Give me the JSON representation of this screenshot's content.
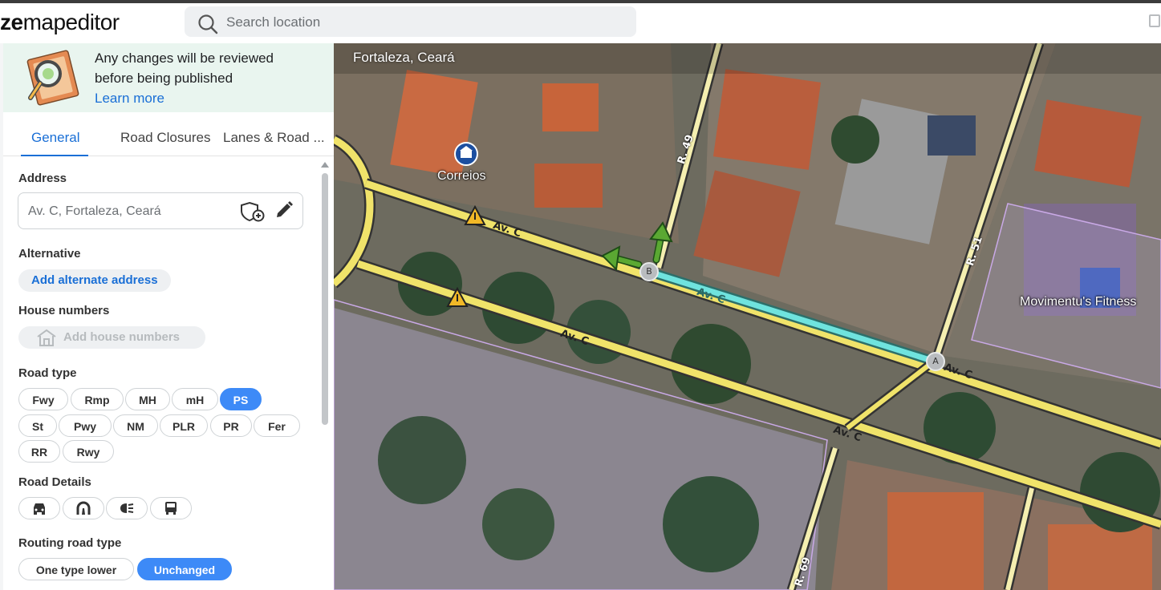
{
  "app": {
    "logo_bold": "ze",
    "logo_light": "mapeditor"
  },
  "search": {
    "placeholder": "Search location"
  },
  "notice": {
    "line1": "Any changes will be reviewed",
    "line2": "before being published",
    "learn_more": "Learn more"
  },
  "tabs": [
    {
      "label": "General",
      "active": true
    },
    {
      "label": "Road Closures",
      "active": false
    },
    {
      "label": "Lanes & Road ...",
      "active": false
    }
  ],
  "address": {
    "label": "Address",
    "placeholder": "Av. C, Fortaleza, Ceará"
  },
  "alternative": {
    "label": "Alternative",
    "button": "Add alternate address"
  },
  "house_numbers": {
    "label": "House numbers",
    "button": "Add house numbers"
  },
  "road_type": {
    "label": "Road type",
    "options": [
      "Fwy",
      "Rmp",
      "MH",
      "mH",
      "PS",
      "St",
      "Pwy",
      "NM",
      "PLR",
      "PR",
      "Fer",
      "RR",
      "Rwy"
    ],
    "selected": "PS"
  },
  "road_details": {
    "label": "Road Details",
    "icons": [
      "car-icon",
      "tunnel-icon",
      "headlights-icon",
      "bus-icon"
    ]
  },
  "routing": {
    "label": "Routing road type",
    "options": [
      "One type lower",
      "Unchanged"
    ],
    "selected": "Unchanged"
  },
  "map": {
    "city": "Fortaleza, Ceará",
    "poi_post": "Correios",
    "poi_gym": "Movimentu's Fitness",
    "street_main": "Av. C",
    "street_r49": "R. 49",
    "street_r51": "R. 51",
    "street_r69": "R. 69",
    "node_a": "A",
    "node_b": "B",
    "colors": {
      "road": "#f0e36a",
      "selected": "#6fe3de",
      "arrow": "#5aa832"
    }
  }
}
